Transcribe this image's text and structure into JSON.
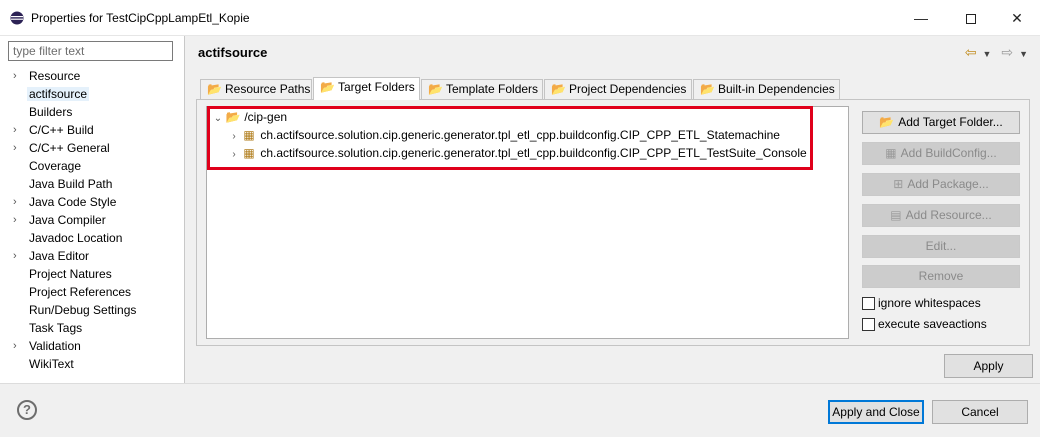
{
  "window": {
    "title": "Properties for TestCipCppLampEtl_Kopie",
    "minimize_glyph": "—",
    "close_glyph": "✕"
  },
  "filter": {
    "placeholder": "type filter text",
    "value": ""
  },
  "nav": {
    "items": [
      {
        "label": "Resource",
        "expandable": true
      },
      {
        "label": "actifsource",
        "expandable": false,
        "selected": true
      },
      {
        "label": "Builders",
        "expandable": false
      },
      {
        "label": "C/C++ Build",
        "expandable": true
      },
      {
        "label": "C/C++ General",
        "expandable": true
      },
      {
        "label": "Coverage",
        "expandable": false
      },
      {
        "label": "Java Build Path",
        "expandable": false
      },
      {
        "label": "Java Code Style",
        "expandable": true
      },
      {
        "label": "Java Compiler",
        "expandable": true
      },
      {
        "label": "Javadoc Location",
        "expandable": false
      },
      {
        "label": "Java Editor",
        "expandable": true
      },
      {
        "label": "Project Natures",
        "expandable": false
      },
      {
        "label": "Project References",
        "expandable": false
      },
      {
        "label": "Run/Debug Settings",
        "expandable": false
      },
      {
        "label": "Task Tags",
        "expandable": false
      },
      {
        "label": "Validation",
        "expandable": true
      },
      {
        "label": "WikiText",
        "expandable": false
      }
    ]
  },
  "page": {
    "title": "actifsource",
    "tabs": [
      {
        "label": "Resource Paths",
        "active": false
      },
      {
        "label": "Target Folders",
        "active": true
      },
      {
        "label": "Template Folders",
        "active": false
      },
      {
        "label": "Project Dependencies",
        "active": false
      },
      {
        "label": "Built-in Dependencies",
        "active": false
      }
    ],
    "tree": {
      "root": "/cip-gen",
      "children": [
        "ch.actifsource.solution.cip.generic.generator.tpl_etl_cpp.buildconfig.CIP_CPP_ETL_Statemachine",
        "ch.actifsource.solution.cip.generic.generator.tpl_etl_cpp.buildconfig.CIP_CPP_ETL_TestSuite_Console"
      ]
    },
    "buttons": {
      "add_target_folder": "Add Target Folder...",
      "add_buildconfig": "Add BuildConfig...",
      "add_package": "Add Package...",
      "add_resource": "Add Resource...",
      "edit": "Edit...",
      "remove": "Remove"
    },
    "checkboxes": {
      "ignore_whitespaces": "ignore whitespaces",
      "execute_saveactions": "execute saveactions"
    },
    "apply": "Apply"
  },
  "footer": {
    "help": "?",
    "apply_and_close": "Apply and Close",
    "cancel": "Cancel"
  },
  "colors": {
    "highlight_box": "#e0001b",
    "selected_nav": "#e5f1fb",
    "default_button_border": "#0078d7",
    "folder_icon": "#c99a2e"
  }
}
